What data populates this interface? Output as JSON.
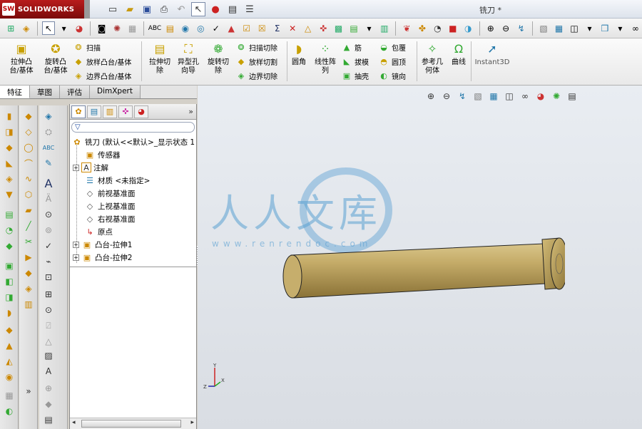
{
  "app": {
    "brand": "SOLIDWORKS",
    "brand_mark": "SW",
    "document_title": "铣刀 *"
  },
  "colors": {
    "brand_red": "#b81c1c",
    "model_body": "#b39a58",
    "watermark": "#5aa0d2"
  },
  "quick_access": [
    {
      "name": "new-icon",
      "glyph": "□"
    },
    {
      "name": "open-icon",
      "glyph": "📂"
    },
    {
      "name": "save-icon",
      "glyph": "💾"
    },
    {
      "name": "print-icon",
      "glyph": "🖶"
    },
    {
      "name": "undo-icon",
      "glyph": "↶"
    },
    {
      "name": "select-icon",
      "glyph": "↖"
    },
    {
      "name": "rebuild-icon",
      "glyph": "🚦"
    },
    {
      "name": "file-properties-icon",
      "glyph": "📄"
    },
    {
      "name": "options-icon",
      "glyph": "☰"
    }
  ],
  "command_manager": {
    "big_buttons": [
      {
        "id": "extrude-boss",
        "label": "拉伸凸\n台/基体"
      },
      {
        "id": "revolve-boss",
        "label": "旋转凸\n台/基体"
      },
      {
        "id": "extrude-cut",
        "label": "拉伸切\n除"
      },
      {
        "id": "hole-wizard",
        "label": "异型孔\n向导"
      },
      {
        "id": "revolve-cut",
        "label": "旋转切\n除"
      },
      {
        "id": "fillet",
        "label": "圆角"
      },
      {
        "id": "linear-pattern",
        "label": "线性阵\n列"
      },
      {
        "id": "reference-geometry",
        "label": "参考几\n何体"
      },
      {
        "id": "curves",
        "label": "曲线"
      },
      {
        "id": "instant3d",
        "label": "Instant3D"
      }
    ],
    "small_buttons": [
      {
        "id": "sweep",
        "label": "扫描"
      },
      {
        "id": "loft-boss",
        "label": "放样凸台/基体"
      },
      {
        "id": "boundary-boss",
        "label": "边界凸台/基体"
      },
      {
        "id": "swept-cut",
        "label": "扫描切除"
      },
      {
        "id": "lofted-cut",
        "label": "放样切割"
      },
      {
        "id": "boundary-cut",
        "label": "边界切除"
      },
      {
        "id": "rib",
        "label": "筋"
      },
      {
        "id": "draft",
        "label": "拔模"
      },
      {
        "id": "shell",
        "label": "抽壳"
      },
      {
        "id": "wrap",
        "label": "包覆"
      },
      {
        "id": "dome",
        "label": "圆顶"
      },
      {
        "id": "mirror",
        "label": "镜向"
      }
    ]
  },
  "tabs": [
    {
      "id": "features",
      "label": "特征",
      "active": true
    },
    {
      "id": "sketch",
      "label": "草图",
      "active": false
    },
    {
      "id": "evaluate",
      "label": "评估",
      "active": false
    },
    {
      "id": "dimxpert",
      "label": "DimXpert",
      "active": false
    }
  ],
  "feature_tree": {
    "root": "铣刀 (默认<<默认>_显示状态 1",
    "nodes": [
      {
        "id": "sensors",
        "label": "传感器",
        "icon": "sensor-folder-icon",
        "expandable": false
      },
      {
        "id": "annotations",
        "label": "注解",
        "icon": "annotation-icon",
        "expandable": true
      },
      {
        "id": "material",
        "label": "材质 <未指定>",
        "icon": "material-icon",
        "expandable": false
      },
      {
        "id": "front-plane",
        "label": "前视基准面",
        "icon": "plane-icon",
        "expandable": false
      },
      {
        "id": "top-plane",
        "label": "上视基准面",
        "icon": "plane-icon",
        "expandable": false
      },
      {
        "id": "right-plane",
        "label": "右视基准面",
        "icon": "plane-icon",
        "expandable": false
      },
      {
        "id": "origin",
        "label": "原点",
        "icon": "origin-icon",
        "expandable": false
      },
      {
        "id": "boss-extrude1",
        "label": "凸台-拉伸1",
        "icon": "extrude-feature-icon",
        "expandable": true
      },
      {
        "id": "boss-extrude2",
        "label": "凸台-拉伸2",
        "icon": "extrude-feature-icon",
        "expandable": true
      }
    ]
  },
  "watermark": {
    "text": "人人文库",
    "url": "www.renrendoc.com"
  },
  "triad": {
    "x": "X",
    "y": "Y",
    "z": "Z"
  }
}
